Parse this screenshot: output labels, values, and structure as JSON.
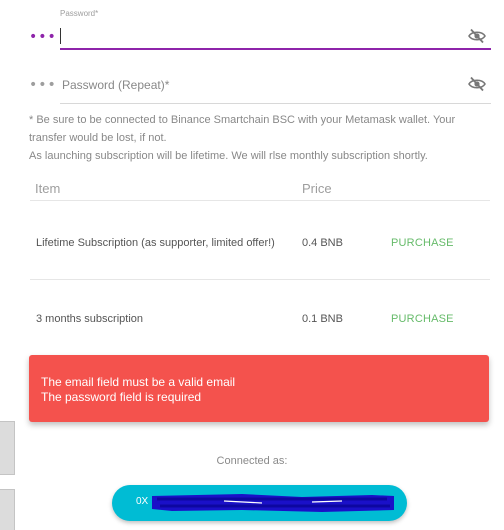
{
  "password_field": {
    "label": "Password*",
    "value": "",
    "icon": "dots-icon",
    "visibility_icon": "eye-off-icon",
    "accent_color": "#8e24aa"
  },
  "password_repeat_field": {
    "placeholder": "Password (Repeat)*",
    "value": "",
    "icon": "dots-icon",
    "visibility_icon": "eye-off-icon"
  },
  "notes": {
    "line1": "* Be sure to be connected to Binance Smartchain BSC with your Metamask wallet. Your transfer would be lost, if not.",
    "line2": "As launching subscription will be lifetime. We will rlse monthly subscription shortly."
  },
  "table": {
    "headers": {
      "item": "Item",
      "price": "Price"
    },
    "rows": [
      {
        "name": "Lifetime Subscription (as supporter, limited offer!)",
        "price": "0.4 BNB",
        "action": "PURCHASE"
      },
      {
        "name": "3 months subscription",
        "price": "0.1 BNB",
        "action": "PURCHASE"
      }
    ]
  },
  "error": {
    "line1": "The email field must be a valid email",
    "line2": "The password field is required",
    "color": "#f4524d"
  },
  "connected": {
    "label": "Connected as:",
    "address_prefix": "0X",
    "button_color": "#00bcd4"
  }
}
